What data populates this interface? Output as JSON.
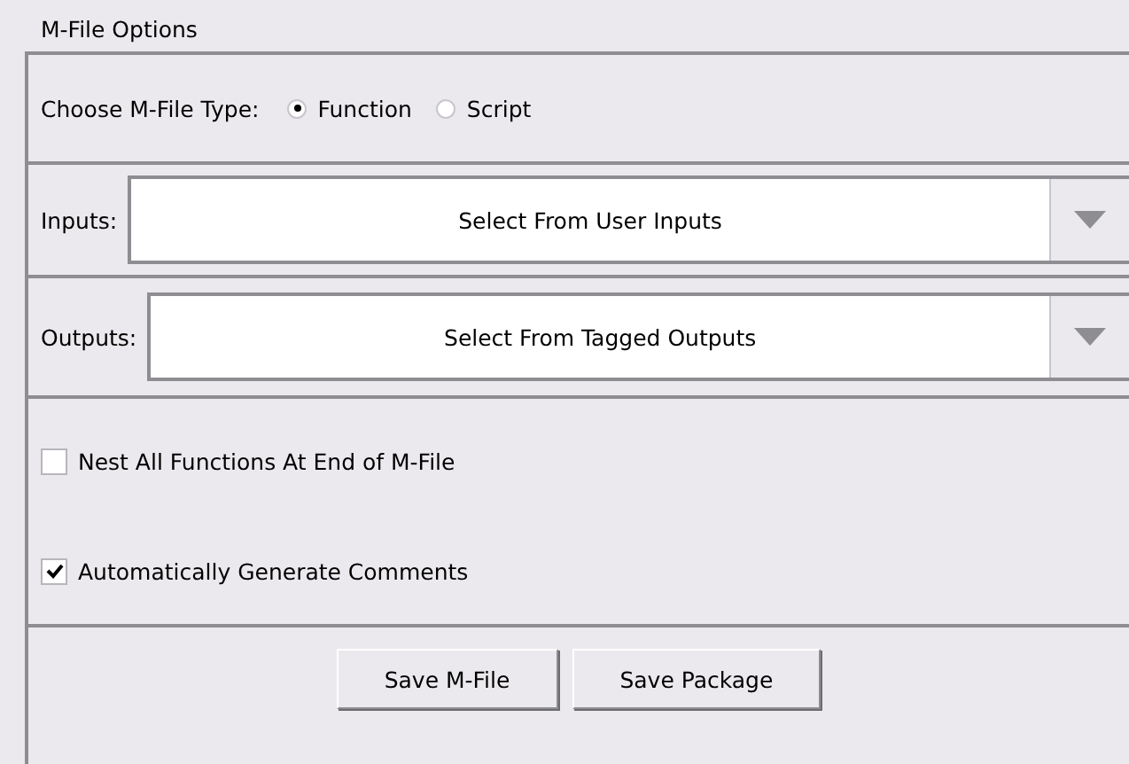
{
  "title": "M-File Options",
  "type_choice": {
    "label": "Choose M-File Type:",
    "options": [
      {
        "label": "Function",
        "selected": true
      },
      {
        "label": "Script",
        "selected": false
      }
    ]
  },
  "combos": [
    {
      "label": "Inputs:",
      "value": "Select From User Inputs"
    },
    {
      "label": "Outputs:",
      "value": "Select From Tagged Outputs"
    }
  ],
  "checkboxes": [
    {
      "label": "Nest All Functions At End of M-File",
      "checked": false
    },
    {
      "label": "Automatically Generate Comments",
      "checked": true
    }
  ],
  "buttons": [
    "Save M-File",
    "Save Package"
  ]
}
